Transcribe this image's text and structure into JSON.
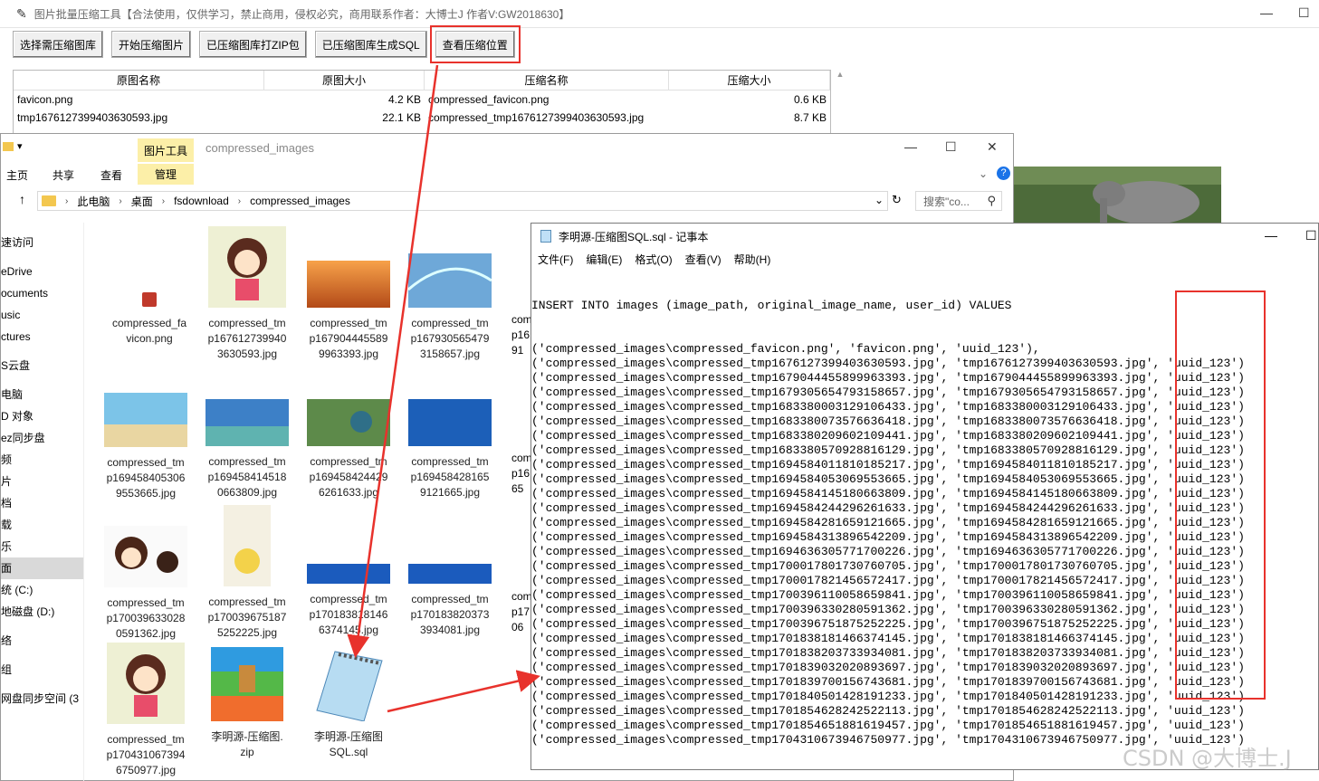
{
  "app": {
    "title": "图片批量压缩工具【合法使用，仅供学习，禁止商用，侵权必究，商用联系作者：大博士J 作者V:GW2018630】",
    "buttons": [
      "选择需压缩图库",
      "开始压缩图片",
      "已压缩图库打ZIP包",
      "已压缩图库生成SQL",
      "查看压缩位置"
    ],
    "table": {
      "headers": [
        "原图名称",
        "原图大小",
        "压缩名称",
        "压缩大小"
      ],
      "rows": [
        [
          "favicon.png",
          "4.2 KB",
          "compressed_favicon.png",
          "0.6 KB"
        ],
        [
          "tmp1676127399403630593.jpg",
          "22.1 KB",
          "compressed_tmp1676127399403630593.jpg",
          "8.7 KB"
        ]
      ]
    }
  },
  "explorer": {
    "tool_tab": "图片工具",
    "title": "compressed_images",
    "ribbon": [
      "主页",
      "共享",
      "查看",
      "管理"
    ],
    "breadcrumb": [
      "此电脑",
      "桌面",
      "fsdownload",
      "compressed_images"
    ],
    "search_placeholder": "搜索\"co...",
    "nav": [
      "速访问",
      "eDrive",
      "ocuments",
      "usic",
      "ctures",
      "S云盘",
      "电脑",
      "D 对象",
      "ez同步盘",
      "频",
      "片",
      "档",
      "载",
      "乐",
      "面",
      "统 (C:)",
      "地磁盘 (D:)",
      "络",
      "组",
      "网盘同步空间 (3"
    ],
    "files": [
      {
        "l1": "compressed_fa",
        "l2": "vicon.png",
        "l3": ""
      },
      {
        "l1": "compressed_tm",
        "l2": "p167612739940",
        "l3": "3630593.jpg"
      },
      {
        "l1": "compressed_tm",
        "l2": "p167904445589",
        "l3": "9963393.jpg"
      },
      {
        "l1": "compressed_tm",
        "l2": "p167930565479",
        "l3": "3158657.jpg"
      },
      {
        "l1": "compressed_tm",
        "l2": "p169458405306",
        "l3": "9553665.jpg"
      },
      {
        "l1": "compressed_tm",
        "l2": "p169458414518",
        "l3": "0663809.jpg"
      },
      {
        "l1": "compressed_tm",
        "l2": "p169458424429",
        "l3": "6261633.jpg"
      },
      {
        "l1": "compressed_tm",
        "l2": "p169458428165",
        "l3": "9121665.jpg"
      },
      {
        "l1": "compressed_tm",
        "l2": "p170039633028",
        "l3": "0591362.jpg"
      },
      {
        "l1": "compressed_tm",
        "l2": "p170039675187",
        "l3": "5252225.jpg"
      },
      {
        "l1": "compressed_tm",
        "l2": "p170183818146",
        "l3": "6374145.jpg"
      },
      {
        "l1": "compressed_tm",
        "l2": "p170183820373",
        "l3": "3934081.jpg"
      },
      {
        "l1": "compressed_tm",
        "l2": "p170431067394",
        "l3": "6750977.jpg"
      },
      {
        "l1": "李明源-压缩图.",
        "l2": "zip",
        "l3": ""
      },
      {
        "l1": "李明源-压缩图",
        "l2": "SQL.sql",
        "l3": ""
      }
    ],
    "partial_col": [
      "com",
      "p16",
      "91",
      "com",
      "p16",
      "65",
      "com",
      "p17",
      "06"
    ]
  },
  "notepad": {
    "title": "李明源-压缩图SQL.sql - 记事本",
    "menu": [
      "文件(F)",
      "编辑(E)",
      "格式(O)",
      "查看(V)",
      "帮助(H)"
    ],
    "header_line": "INSERT INTO images (image_path, original_image_name, user_id) VALUES",
    "rows": [
      [
        "compressed_favicon.png",
        "favicon.png",
        "uuid_123",
        "),"
      ],
      [
        "compressed_tmp1676127399403630593.jpg",
        "tmp1676127399403630593.jpg",
        "uuid_123",
        ")"
      ],
      [
        "compressed_tmp1679044455899963393.jpg",
        "tmp1679044455899963393.jpg",
        "uuid_123",
        ")"
      ],
      [
        "compressed_tmp1679305654793158657.jpg",
        "tmp1679305654793158657.jpg",
        "uuid_123",
        ")"
      ],
      [
        "compressed_tmp1683380003129106433.jpg",
        "tmp1683380003129106433.jpg",
        "uuid_123",
        ")"
      ],
      [
        "compressed_tmp1683380073576636418.jpg",
        "tmp1683380073576636418.jpg",
        "uuid_123",
        ")"
      ],
      [
        "compressed_tmp1683380209602109441.jpg",
        "tmp1683380209602109441.jpg",
        "uuid_123",
        ")"
      ],
      [
        "compressed_tmp1683380570928816129.jpg",
        "tmp1683380570928816129.jpg",
        "uuid_123",
        ")"
      ],
      [
        "compressed_tmp1694584011810185217.jpg",
        "tmp1694584011810185217.jpg",
        "uuid_123",
        ")"
      ],
      [
        "compressed_tmp1694584053069553665.jpg",
        "tmp1694584053069553665.jpg",
        "uuid_123",
        ")"
      ],
      [
        "compressed_tmp1694584145180663809.jpg",
        "tmp1694584145180663809.jpg",
        "uuid_123",
        ")"
      ],
      [
        "compressed_tmp1694584244296261633.jpg",
        "tmp1694584244296261633.jpg",
        "uuid_123",
        ")"
      ],
      [
        "compressed_tmp1694584281659121665.jpg",
        "tmp1694584281659121665.jpg",
        "uuid_123",
        ")"
      ],
      [
        "compressed_tmp1694584313896542209.jpg",
        "tmp1694584313896542209.jpg",
        "uuid_123",
        ")"
      ],
      [
        "compressed_tmp1694636305771700226.jpg",
        "tmp1694636305771700226.jpg",
        "uuid_123",
        ")"
      ],
      [
        "compressed_tmp1700017801730760705.jpg",
        "tmp1700017801730760705.jpg",
        "uuid_123",
        ")"
      ],
      [
        "compressed_tmp1700017821456572417.jpg",
        "tmp1700017821456572417.jpg",
        "uuid_123",
        ")"
      ],
      [
        "compressed_tmp1700396110058659841.jpg",
        "tmp1700396110058659841.jpg",
        "uuid_123",
        ")"
      ],
      [
        "compressed_tmp1700396330280591362.jpg",
        "tmp1700396330280591362.jpg",
        "uuid_123",
        ")"
      ],
      [
        "compressed_tmp1700396751875252225.jpg",
        "tmp1700396751875252225.jpg",
        "uuid_123",
        ")"
      ],
      [
        "compressed_tmp1701838181466374145.jpg",
        "tmp1701838181466374145.jpg",
        "uuid_123",
        ")"
      ],
      [
        "compressed_tmp1701838203733934081.jpg",
        "tmp1701838203733934081.jpg",
        "uuid_123",
        ")"
      ],
      [
        "compressed_tmp1701839032020893697.jpg",
        "tmp1701839032020893697.jpg",
        "uuid_123",
        ")"
      ],
      [
        "compressed_tmp1701839700156743681.jpg",
        "tmp1701839700156743681.jpg",
        "uuid_123",
        ")"
      ],
      [
        "compressed_tmp1701840501428191233.jpg",
        "tmp1701840501428191233.jpg",
        "uuid_123",
        ")"
      ],
      [
        "compressed_tmp1701854628242522113.jpg",
        "tmp1701854628242522113.jpg",
        "uuid_123",
        ")"
      ],
      [
        "compressed_tmp1701854651881619457.jpg",
        "tmp1701854651881619457.jpg",
        "uuid_123",
        ")"
      ],
      [
        "compressed_tmp1704310673946750977.jpg",
        "tmp1704310673946750977.jpg",
        "uuid_123",
        ")"
      ]
    ]
  },
  "watermark": "CSDN @大博士.J",
  "colors": {
    "annotation_red": "#e8322c",
    "tool_tab": "#fcefa8"
  }
}
